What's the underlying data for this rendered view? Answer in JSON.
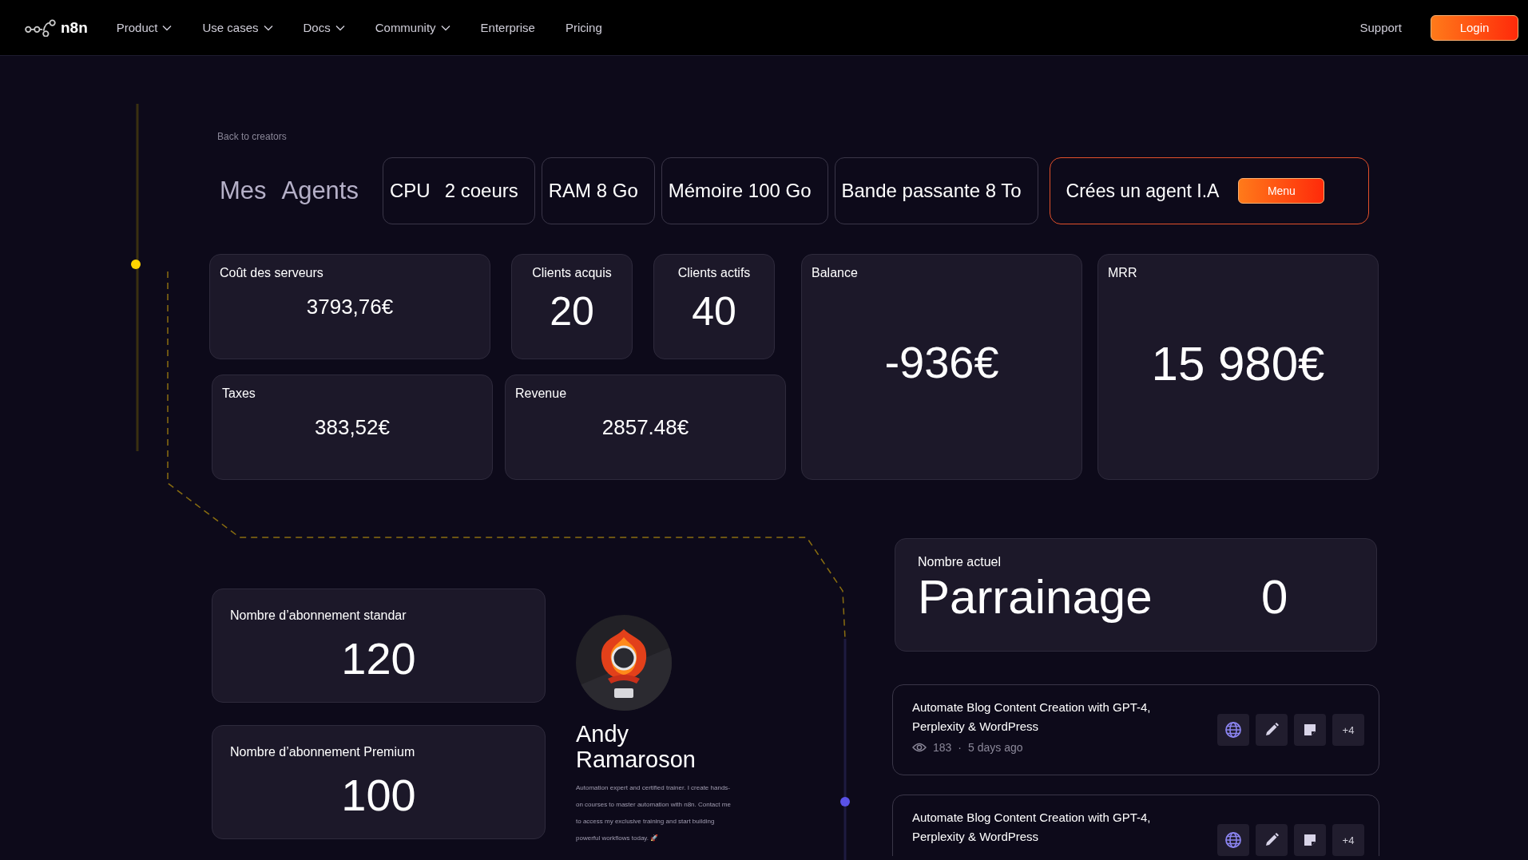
{
  "nav": {
    "brand": "n8n",
    "items": [
      {
        "label": "Product",
        "has_dropdown": true
      },
      {
        "label": "Use cases",
        "has_dropdown": true
      },
      {
        "label": "Docs",
        "has_dropdown": true
      },
      {
        "label": "Community",
        "has_dropdown": true
      },
      {
        "label": "Enterprise",
        "has_dropdown": false
      },
      {
        "label": "Pricing",
        "has_dropdown": false
      }
    ],
    "support": "Support",
    "login": "Login"
  },
  "back_link": "Back to creators",
  "title": "Mes Agents",
  "resources": [
    {
      "label": "CPU",
      "value": "2 coeurs"
    },
    {
      "label": "RAM 8 Go"
    },
    {
      "label": "Mémoire 100 Go"
    },
    {
      "label": "Bande passante 8 To"
    }
  ],
  "create_agent": {
    "label": "Crées un agent I.A",
    "button": "Menu"
  },
  "stats": [
    {
      "label": "Coût des serveurs",
      "value": "3793,76€",
      "kind": "amount"
    },
    {
      "label": "Clients acquis",
      "value": "20",
      "kind": "count"
    },
    {
      "label": "Clients actifs",
      "value": "40",
      "kind": "count"
    },
    {
      "label": "Balance",
      "value": "-936€",
      "kind": "headline"
    },
    {
      "label": "MRR",
      "value": "15 980€",
      "kind": "headline"
    },
    {
      "label": "Taxes",
      "value": "383,52€",
      "kind": "amount"
    },
    {
      "label": "Revenue",
      "value": "2857.48€",
      "kind": "amount"
    }
  ],
  "subscriptions": [
    {
      "label": "Nombre d’abonnement standar",
      "value": "120"
    },
    {
      "label": "Nombre d’abonnement Premium",
      "value": "100"
    }
  ],
  "profile": {
    "name": "Andy Ramaroson",
    "bio": "Automation expert and certified trainer. I create hands-on courses to master automation with n8n. Contact me to access my exclusive training and start building powerful workflows today. 🚀"
  },
  "referral": {
    "label": "Nombre actuel",
    "title": "Parrainage",
    "value": "0"
  },
  "workflows": [
    {
      "title": "Automate Blog Content Creation with GPT-4, Perplexity & WordPress",
      "views": "183",
      "separator": "·",
      "age": "5 days ago",
      "tools": [
        {
          "kind": "globe"
        },
        {
          "kind": "pencil"
        },
        {
          "kind": "note"
        }
      ],
      "more": "+4"
    },
    {
      "title": "Automate Blog Content Creation with GPT-4, Perplexity & WordPress",
      "tools": [
        {
          "kind": "globe"
        },
        {
          "kind": "pencil"
        },
        {
          "kind": "note"
        }
      ],
      "more": "+4"
    }
  ]
}
